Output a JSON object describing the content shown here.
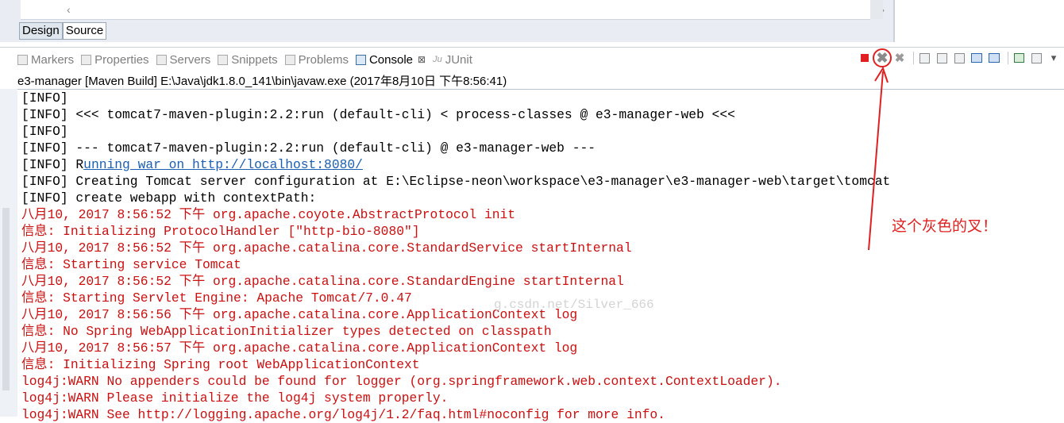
{
  "editor": {
    "mode_tabs": [
      "Design",
      "Source"
    ]
  },
  "views": {
    "tabs": [
      {
        "label": "Markers",
        "icon": "markers-icon"
      },
      {
        "label": "Properties",
        "icon": "properties-icon"
      },
      {
        "label": "Servers",
        "icon": "servers-icon"
      },
      {
        "label": "Snippets",
        "icon": "snippets-icon"
      },
      {
        "label": "Problems",
        "icon": "problems-icon"
      },
      {
        "label": "Console",
        "icon": "console-icon",
        "active": true,
        "close": "⊠"
      },
      {
        "label": "JUnit",
        "icon": "junit-icon",
        "prefix": "Ju"
      }
    ]
  },
  "toolbar": {
    "buttons": [
      "terminate-icon",
      "remove-launch-icon",
      "remove-all-terminated-icon",
      "clear-console-icon",
      "scroll-lock-icon",
      "word-wrap-icon",
      "show-on-stdout-icon",
      "show-on-stderr-icon",
      "pin-console-icon",
      "display-console-icon",
      "view-menu-icon"
    ],
    "stop_color": "#e02020"
  },
  "process_title": "e3-manager [Maven Build] E:\\Java\\jdk1.8.0_141\\bin\\javaw.exe (2017年8月10日 下午8:56:41)",
  "console": {
    "lines": [
      {
        "text": "[INFO]",
        "color": "black"
      },
      {
        "text": "[INFO] <<< tomcat7-maven-plugin:2.2:run (default-cli) < process-classes @ e3-manager-web <<<",
        "color": "black"
      },
      {
        "text": "[INFO]",
        "color": "black"
      },
      {
        "text": "[INFO] --- tomcat7-maven-plugin:2.2:run (default-cli) @ e3-manager-web ---",
        "color": "black"
      },
      {
        "text": "[INFO] Running war on http://localhost:8080/",
        "color": "black"
      },
      {
        "text": "[INFO] Creating Tomcat server configuration at E:\\Eclipse-neon\\workspace\\e3-manager\\e3-manager-web\\target\\tomcat",
        "color": "black"
      },
      {
        "text": "[INFO] create webapp with contextPath:",
        "color": "black"
      },
      {
        "text": "八月10, 2017 8:56:52 下午 org.apache.coyote.AbstractProtocol init",
        "color": "red"
      },
      {
        "text": "信息: Initializing ProtocolHandler [\"http-bio-8080\"]",
        "color": "red"
      },
      {
        "text": "八月10, 2017 8:56:52 下午 org.apache.catalina.core.StandardService startInternal",
        "color": "red"
      },
      {
        "text": "信息: Starting service Tomcat",
        "color": "red"
      },
      {
        "text": "八月10, 2017 8:56:52 下午 org.apache.catalina.core.StandardEngine startInternal",
        "color": "red"
      },
      {
        "text": "信息: Starting Servlet Engine: Apache Tomcat/7.0.47",
        "color": "red"
      },
      {
        "text": "八月10, 2017 8:56:56 下午 org.apache.catalina.core.ApplicationContext log",
        "color": "red"
      },
      {
        "text": "信息: No Spring WebApplicationInitializer types detected on classpath",
        "color": "red"
      },
      {
        "text": "八月10, 2017 8:56:57 下午 org.apache.catalina.core.ApplicationContext log",
        "color": "red"
      },
      {
        "text": "信息: Initializing Spring root WebApplicationContext",
        "color": "red"
      },
      {
        "text": "log4j:WARN No appenders could be found for logger (org.springframework.web.context.ContextLoader).",
        "color": "red"
      },
      {
        "text": "log4j:WARN Please initialize the log4j system properly.",
        "color": "red"
      },
      {
        "text": "log4j:WARN See http://logging.apache.org/log4j/1.2/faq.html#noconfig for more info.",
        "color": "red"
      }
    ],
    "link_text": "unning war on http://localhost:8080/",
    "watermark": "g.csdn.net/Silver_666"
  },
  "annotation": {
    "text": "这个灰色的叉！",
    "color": "#e02020"
  }
}
